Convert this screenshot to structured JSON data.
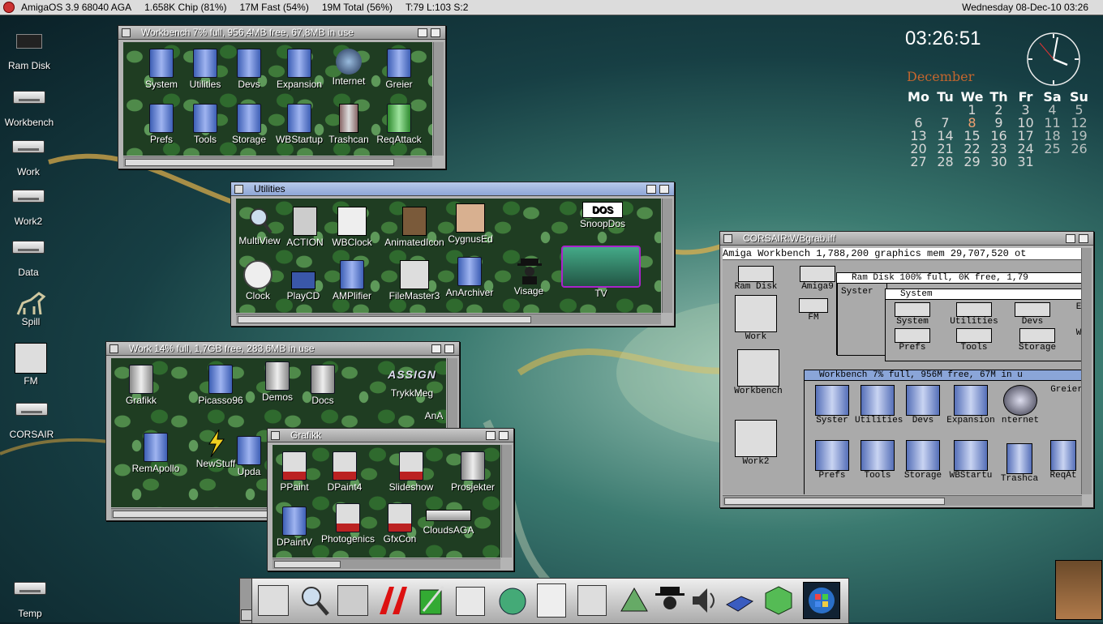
{
  "menubar": {
    "os": "AmigaOS 3.9 68040 AGA",
    "chip": "1.658K Chip (81%)",
    "fast": "17M Fast (54%)",
    "total": "19M Total (56%)",
    "tasks": "T:79 L:103 S:2",
    "date": "Wednesday 08-Dec-10 03:26"
  },
  "desktop_icons": [
    "Ram Disk",
    "Workbench",
    "Work",
    "Work2",
    "Data",
    "Spill",
    "FM",
    "CORSAIR",
    "Temp"
  ],
  "clock": {
    "time": "03:26:51"
  },
  "calendar": {
    "month": "December",
    "headers": [
      "Mo",
      "Tu",
      "We",
      "Th",
      "Fr",
      "Sa",
      "Su"
    ],
    "weeks": [
      [
        "",
        "",
        "1",
        "2",
        "3",
        "4",
        "5"
      ],
      [
        "6",
        "7",
        "8",
        "9",
        "10",
        "11",
        "12"
      ],
      [
        "13",
        "14",
        "15",
        "16",
        "17",
        "18",
        "19"
      ],
      [
        "20",
        "21",
        "22",
        "23",
        "24",
        "25",
        "26"
      ],
      [
        "27",
        "28",
        "29",
        "30",
        "31",
        "",
        ""
      ]
    ]
  },
  "workbench_window": {
    "title": "Workbench  7% full, 956,4MB free, 67,8MB in use",
    "icons": [
      "System",
      "Utilities",
      "Devs",
      "Expansion",
      "Internet",
      "Greier",
      "Prefs",
      "Tools",
      "Storage",
      "WBStartup",
      "Trashcan",
      "ReqAttack"
    ]
  },
  "utilities_window": {
    "title": "Utilities",
    "icons": [
      "MultiView",
      "ACTION",
      "WBClock",
      "AnimatedIcon",
      "CygnusEd",
      "SnoopDos",
      "Clock",
      "PlayCD",
      "AMPlifier",
      "FileMaster3",
      "AnArchiver",
      "Visage",
      "TV"
    ]
  },
  "work_window": {
    "title": "Work  14% full, 1,7GB free, 283,6MB in use",
    "icons": [
      "Grafikk",
      "Picasso96",
      "Demos",
      "Docs",
      "TrykkMeg",
      "RemApollo",
      "NewStuff",
      "Upda",
      "AnA"
    ],
    "assign_label": "ASSIGN"
  },
  "grafikk_window": {
    "title": "Grafikk",
    "icons": [
      "PPaint",
      "DPaint4",
      "Slideshow",
      "Prosjekter",
      "DPaintV",
      "Photogenics",
      "GfxCon",
      "CloudsAGA"
    ]
  },
  "grab_window": {
    "title": "CORSAIR:WBgrab.iff",
    "header": "Amiga Workbench  1,788,200 graphics mem  29,707,520 ot",
    "left_icons": [
      "Ram Disk",
      "Amiga9",
      "FM",
      "Work",
      "Workbench",
      "Work2"
    ],
    "ramdisk_title": "Ram Disk  100% full, 0K free, 1,79",
    "system_title": "System",
    "system_stub": "Syster",
    "system_icons": [
      "System",
      "Utilities",
      "Devs",
      "Prefs",
      "Tools",
      "Storage"
    ],
    "system_stubs": [
      "E",
      "W"
    ],
    "wb_title": "Workbench  7% full, 956M free, 67M in u",
    "wb_icons": [
      "Syster",
      "Utilities",
      "Devs",
      "Expansion",
      "nternet",
      "Greier",
      "Prefs",
      "Tools",
      "Storage",
      "WBStartu",
      "Trashca",
      "ReqAt"
    ]
  },
  "dock_items": [
    "shell-icon",
    "search-icon",
    "filemaster-icon",
    "anarchiver-icon",
    "editor-icon",
    "browser-icon",
    "internet-icon",
    "picasso-icon",
    "action-icon",
    "tool-icon",
    "visage-icon",
    "speaker-icon",
    "drive-icon",
    "cube-icon",
    "windows-icon"
  ],
  "colors": {
    "menubar": "#dcdcdc",
    "active_title": "#9fb5e0",
    "month": "#c4662e"
  }
}
